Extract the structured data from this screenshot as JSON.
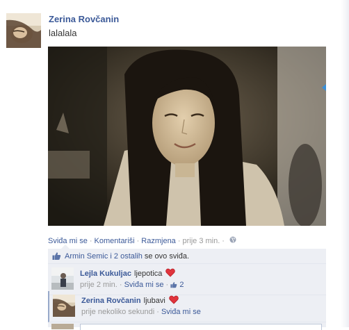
{
  "post": {
    "author": "Zerina Rovčanin",
    "text": "lalalala"
  },
  "actions": {
    "like": "Sviđa mi se",
    "comment": "Komentariši",
    "share": "Razmjena",
    "timestamp": "prije 3 min.",
    "separator": "·",
    "audience_icon": "globe-icon"
  },
  "likes": {
    "names": "Armin Semic i 2 ostalih",
    "suffix": "se ovo sviđa."
  },
  "comments": [
    {
      "author": "Lejla Kukuljac",
      "text": "ljepotica",
      "emoticon": "heart-icon",
      "time": "prije 2 min.",
      "like": "Sviđa mi se",
      "like_count": "2"
    },
    {
      "author": "Zerina Rovčanin",
      "text": "ljubavi",
      "emoticon": "heart-icon",
      "time": "prije nekoliko sekundi",
      "like": "Sviđa mi se"
    }
  ],
  "colors": {
    "link": "#3b5998",
    "meta": "#999999",
    "ufi_bg": "#edeff4",
    "heart": "#e0343c"
  }
}
